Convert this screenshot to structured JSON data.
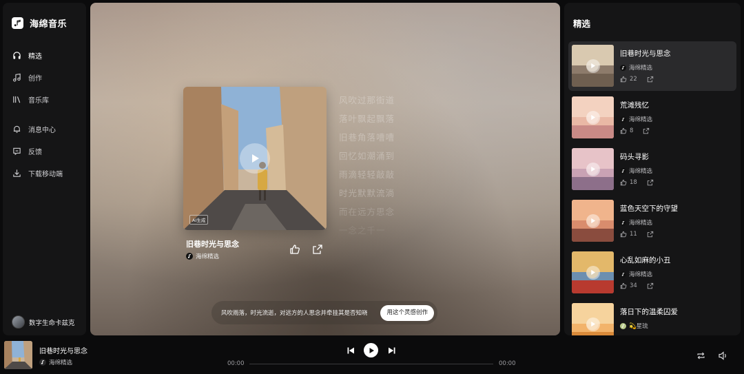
{
  "app": {
    "name": "海绵音乐"
  },
  "sidebar": {
    "items": [
      {
        "label": "精选",
        "icon": "headphones-icon",
        "active": true
      },
      {
        "label": "创作",
        "icon": "music-note-icon",
        "active": false
      },
      {
        "label": "音乐库",
        "icon": "library-icon",
        "active": false
      },
      {
        "label": "消息中心",
        "icon": "bell-icon",
        "active": false
      },
      {
        "label": "反馈",
        "icon": "feedback-icon",
        "active": false
      },
      {
        "label": "下载移动端",
        "icon": "download-icon",
        "active": false
      }
    ],
    "user": {
      "name": "数字生命卡兹克"
    }
  },
  "stage": {
    "ai_tag": "AI生成",
    "song": {
      "title": "旧巷时光与思念",
      "artist": "海绵精选"
    },
    "lyrics": [
      "风吹过那街道",
      "落叶飘起飘落",
      "旧巷角落嘈嘈",
      "回忆如潮涌到",
      "雨滴轻轻敲敲",
      "时光默默流淌",
      "而在远方思念",
      "一念之千一"
    ],
    "prompt": {
      "text": "风吹雨落，时光流逝，对远方的人思念并牵挂其是否知晓",
      "button": "用这个灵感创作"
    }
  },
  "panel": {
    "title": "精选",
    "items": [
      {
        "title": "旧巷时光与思念",
        "artist": "海绵精选",
        "likes": "22",
        "active": true,
        "palette": [
          "#8d7b6b",
          "#d9c9b0",
          "#6f5f50"
        ]
      },
      {
        "title": "荒滩残忆",
        "artist": "海绵精选",
        "likes": "8",
        "active": false,
        "palette": [
          "#e9b8a5",
          "#f3d2c0",
          "#c98a86"
        ]
      },
      {
        "title": "码头寻影",
        "artist": "海绵精选",
        "likes": "18",
        "active": false,
        "palette": [
          "#c9a2b4",
          "#e7c3c8",
          "#8d6f8a"
        ]
      },
      {
        "title": "蓝色天空下的守望",
        "artist": "海绵精选",
        "likes": "11",
        "active": false,
        "palette": [
          "#d98c6d",
          "#f0b48c",
          "#8a4c3e"
        ]
      },
      {
        "title": "心乱如麻的小丑",
        "artist": "海绵精选",
        "likes": "34",
        "active": false,
        "palette": [
          "#6c8fb0",
          "#e3b86a",
          "#b83a2f"
        ]
      },
      {
        "title": "落日下的温柔囚爱",
        "artist": "💫星琉",
        "likes": "",
        "active": false,
        "palette": [
          "#f2b36b",
          "#f6d39d",
          "#d98a3a"
        ]
      }
    ]
  },
  "player": {
    "title": "旧巷时光与思念",
    "artist": "海绵精选",
    "time_current": "00:00",
    "time_total": "00:00",
    "progress": 0
  }
}
